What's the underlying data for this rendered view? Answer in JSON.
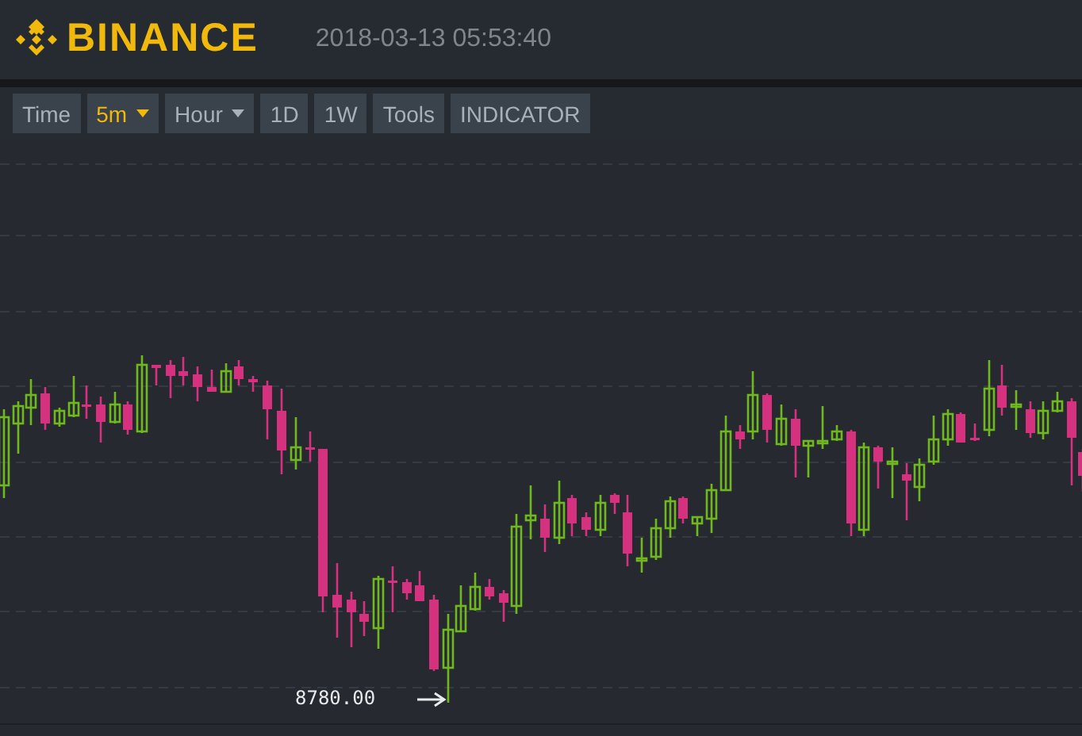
{
  "header": {
    "logo_text": "BINANCE",
    "timestamp": "2018-03-13 05:53:40"
  },
  "toolbar": [
    {
      "label": "Time",
      "selected": false,
      "dropdown": false
    },
    {
      "label": "5m",
      "selected": true,
      "dropdown": true
    },
    {
      "label": "Hour",
      "selected": false,
      "dropdown": true
    },
    {
      "label": "1D",
      "selected": false,
      "dropdown": false
    },
    {
      "label": "1W",
      "selected": false,
      "dropdown": false
    },
    {
      "label": "Tools",
      "selected": false,
      "dropdown": false
    },
    {
      "label": "INDICATOR",
      "selected": false,
      "dropdown": false
    }
  ],
  "chart": {
    "low_label": "8780.00"
  }
}
